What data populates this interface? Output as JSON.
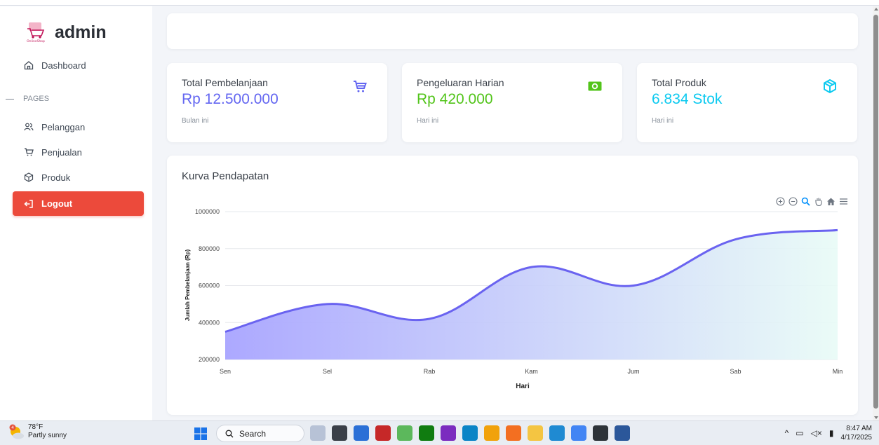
{
  "brand": {
    "name": "admin",
    "logo_text": "OnlineShop"
  },
  "sidebar": {
    "dashboard": "Dashboard",
    "section": "PAGES",
    "items": [
      {
        "label": "Pelanggan",
        "icon": "users-icon"
      },
      {
        "label": "Penjualan",
        "icon": "cart-icon"
      },
      {
        "label": "Produk",
        "icon": "box-icon"
      }
    ],
    "logout": "Logout"
  },
  "stats": [
    {
      "label": "Total Pembelanjaan",
      "value": "Rp 12.500.000",
      "sub": "Bulan ini",
      "color": "#6366f1",
      "icon": "cart-icon"
    },
    {
      "label": "Pengeluaran Harian",
      "value": "Rp 420.000",
      "sub": "Hari ini",
      "color": "#52c41a",
      "icon": "money-icon"
    },
    {
      "label": "Total Produk",
      "value": "6.834 Stok",
      "sub": "Hari ini",
      "color": "#0dcaf0",
      "icon": "box-icon"
    }
  ],
  "chart_card": {
    "title": "Kurva Pendapatan"
  },
  "chart_data": {
    "type": "area",
    "x": [
      "Sen",
      "Sel",
      "Rab",
      "Kam",
      "Jum",
      "Sab",
      "Min"
    ],
    "series": [
      {
        "values": [
          350000,
          500000,
          420000,
          700000,
          600000,
          850000,
          900000
        ]
      }
    ],
    "xlabel": "Hari",
    "ylabel": "Jumlah Pembelanjaan (Rp)",
    "ylim": [
      200000,
      1000000
    ],
    "yticks": [
      "1000000",
      "800000",
      "600000",
      "400000",
      "200000"
    ],
    "line_color": "#6a63f0",
    "fill_gradient": [
      "#a8a4ff",
      "#e8fbf6"
    ],
    "grid": true
  },
  "taskbar": {
    "weather_temp": "78°F",
    "weather_desc": "Partly sunny",
    "weather_badge": "4",
    "search": "Search",
    "time": "8:47 AM",
    "date": "4/17/2025"
  }
}
